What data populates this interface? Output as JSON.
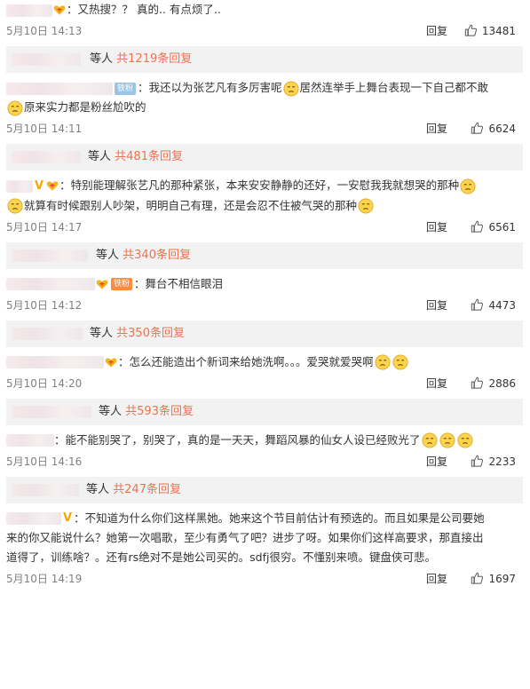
{
  "comments": [
    {
      "text": "又热搜？？ 真的.. 有点烦了..",
      "time": "5月10日 14:13",
      "reply": "回复",
      "likes": "13481",
      "replies_prefix": "等人",
      "replies_count": "共1219条回复"
    },
    {
      "badge": "铁粉",
      "text_a": "我还以为张艺凡有多厉害呢",
      "text_b": "居然连举手上舞台表现一下自己都不敢",
      "text_c": "原来实力都是粉丝尬吹的",
      "time": "5月10日 14:11",
      "reply": "回复",
      "likes": "6624",
      "replies_prefix": "等人",
      "replies_count": "共481条回复"
    },
    {
      "text_a": "特别能理解张艺凡的那种紧张，本来安安静静的还好，一安慰我我就想哭的那种",
      "text_b": "就算有时候跟别人吵架，明明自己有理，还是会忍不住被气哭的那种",
      "time": "5月10日 14:17",
      "reply": "回复",
      "likes": "6561",
      "replies_prefix": "等人",
      "replies_count": "共340条回复"
    },
    {
      "badge": "铁粉",
      "text": "舞台不相信眼泪",
      "time": "5月10日 14:12",
      "reply": "回复",
      "likes": "4473",
      "replies_prefix": "等人",
      "replies_count": "共350条回复"
    },
    {
      "text": "怎么还能造出个新词来给她洗啊。。。爱哭就爱哭啊",
      "time": "5月10日 14:20",
      "reply": "回复",
      "likes": "2886",
      "replies_prefix": "等人",
      "replies_count": "共593条回复"
    },
    {
      "text": "能不能别哭了，别哭了，真的是一天天，舞蹈风暴的仙女人设已经败光了",
      "time": "5月10日 14:16",
      "reply": "回复",
      "likes": "2233",
      "replies_prefix": "等人",
      "replies_count": "共247条回复"
    },
    {
      "text_a": "不知道为什么你们这样黑她。她来这个节目前估计有预选的。而且如果是公司要她",
      "text_b": "来的你又能说什么？她第一次唱歌，至少有勇气了吧？进步了呀。如果你们这样高要求，那直接出",
      "text_c": "道得了，训练啥？。还有rs绝对不是她公司买的。sdfj很穷。不懂别来喷。键盘侠可悲。",
      "time": "5月10日 14:19",
      "reply": "回复",
      "likes": "1697"
    }
  ],
  "icons": {
    "like": "thumbs-up-icon",
    "heart": "heart-badge-icon",
    "emoji": "face-emoji-icon"
  },
  "colors": {
    "reply_count": "#eb7350",
    "vip": "#f6a800",
    "badge_blue": "#9bc3e4",
    "badge_orange": "#ff8b3c"
  }
}
